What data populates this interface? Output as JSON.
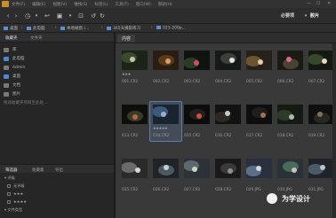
{
  "menu": [
    "文件(F)",
    "编辑(E)",
    "视图(V)",
    "堆栈(S)",
    "标签(L)",
    "工具(T)",
    "窗口(W)",
    "帮助(H)"
  ],
  "toolbar": {
    "ws_essentials": "必要项",
    "ws_library": "胶片"
  },
  "path": [
    "桌面",
    "此电脑",
    "本地磁盘 (...",
    "365天摄影练习",
    "023-200p..."
  ],
  "left_tabs": [
    "收藏夹",
    "文件夹"
  ],
  "folders": [
    "库",
    "此电脑",
    "Admin",
    "桌面",
    "文档",
    "图片",
    "拖动收藏夹项目至此处..."
  ],
  "filter_tabs": [
    "筛选器",
    "收藏集",
    "导出"
  ],
  "filters": [
    "▾ 评级",
    "无评级",
    "★★★",
    "★★★★",
    "▾ 文件类型"
  ],
  "content_tab": "内容",
  "thumbnails": [
    {
      "label": "001.CR2",
      "stars": "★★★"
    },
    {
      "label": "002.CR2",
      "stars": ""
    },
    {
      "label": "003.CR2",
      "stars": ""
    },
    {
      "label": "004.CR2",
      "stars": ""
    },
    {
      "label": "005.CR2",
      "stars": ""
    },
    {
      "label": "006.CR2",
      "stars": ""
    },
    {
      "label": "007.CR2",
      "stars": ""
    },
    {
      "label": "013.CR2",
      "stars": ""
    },
    {
      "label": "014.CR2",
      "stars": "★★★★★"
    },
    {
      "label": "015.CR2",
      "stars": ""
    },
    {
      "label": "016.CR2",
      "stars": ""
    },
    {
      "label": "017.CR2",
      "stars": ""
    },
    {
      "label": "018.CR2",
      "stars": ""
    },
    {
      "label": "019.CR2",
      "stars": ""
    },
    {
      "label": "025.CR2",
      "stars": ""
    },
    {
      "label": "026.CR2",
      "stars": ""
    },
    {
      "label": "027.CR2",
      "stars": ""
    },
    {
      "label": "028.CR2",
      "stars": ""
    },
    {
      "label": "029.JPG",
      "stars": ""
    },
    {
      "label": "030.JPG",
      "stars": ""
    },
    {
      "label": "031.JPG",
      "stars": ""
    }
  ],
  "watermark": "为学设计",
  "colors": {
    "accent": "#4a87d8",
    "bg": "#393939"
  }
}
